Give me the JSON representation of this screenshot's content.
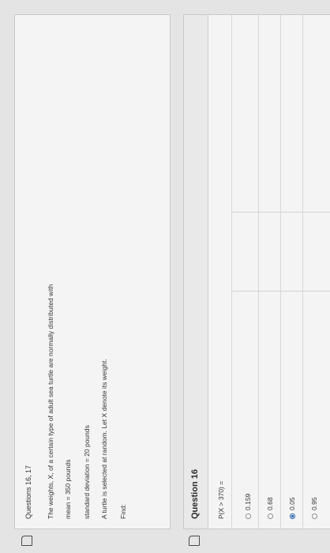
{
  "context": {
    "title": "Questions 16, 17",
    "lines": [
      "The weights, X, of a certain type of adult sea turtle are normally distributed with",
      "mean = 350 pounds",
      "standard deviation = 20 pounds",
      "A turtle is selected at random. Let X denote its weight.",
      "Find:"
    ]
  },
  "question": {
    "title": "Question 16",
    "prompt": "P(X > 370) =",
    "options": [
      {
        "label": "0.159",
        "selected": false
      },
      {
        "label": "0.68",
        "selected": false
      },
      {
        "label": "0.05",
        "selected": true
      },
      {
        "label": "0.95",
        "selected": false
      }
    ]
  },
  "colors": {
    "selected": "#1f5fa8",
    "card_bg": "#f4f4f4",
    "page_bg": "#e4e4e4"
  },
  "icons": {
    "flag": "flag-icon"
  }
}
